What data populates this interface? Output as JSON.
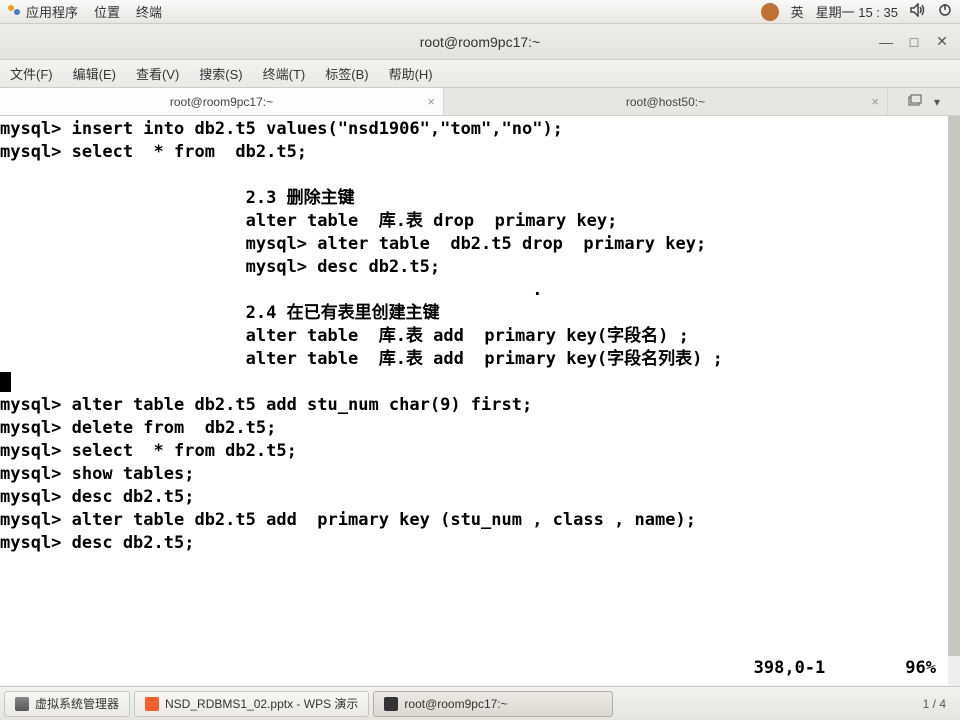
{
  "sysbar": {
    "apps": "应用程序",
    "places": "位置",
    "terminal": "终端",
    "lang": "英",
    "datetime": "星期一 15 : 35"
  },
  "window": {
    "title": "root@room9pc17:~"
  },
  "menu": {
    "file": "文件(F)",
    "edit": "编辑(E)",
    "view": "查看(V)",
    "search": "搜索(S)",
    "terminal": "终端(T)",
    "tabs": "标签(B)",
    "help": "帮助(H)"
  },
  "tabs": {
    "t1": "root@room9pc17:~",
    "t2": "root@host50:~"
  },
  "terminal": {
    "l1": "mysql> insert into db2.t5 values(\"nsd1906\",\"tom\",\"no\");",
    "l2": "mysql> select  * from  db2.t5;",
    "l3": "",
    "l4": "                        2.3 删除主键",
    "l5": "                        alter table  库.表 drop  primary key;",
    "l6": "                        mysql> alter table  db2.t5 drop  primary key;",
    "l7": "                        mysql> desc db2.t5;",
    "l7b": "                                                    .",
    "l8": "                        2.4 在已有表里创建主键",
    "l9": "                        alter table  库.表 add  primary key(字段名) ;",
    "l10": "                        alter table  库.表 add  primary key(字段名列表) ;",
    "l11": "mysql> alter table db2.t5 add stu_num char(9) first;",
    "l12": "mysql> delete from  db2.t5;",
    "l13": "mysql> select  * from db2.t5;",
    "l14": "mysql> show tables;",
    "l15": "mysql> desc db2.t5;",
    "l16": "mysql> alter table db2.t5 add  primary key (stu_num , class , name);",
    "l17": "mysql> desc db2.t5;"
  },
  "status": {
    "pos": "398,0-1",
    "pct": "96%"
  },
  "taskbar": {
    "vm": "虚拟系统管理器",
    "wps": "NSD_RDBMS1_02.pptx - WPS 演示",
    "term": "root@room9pc17:~",
    "workspace": "1 / 4"
  }
}
